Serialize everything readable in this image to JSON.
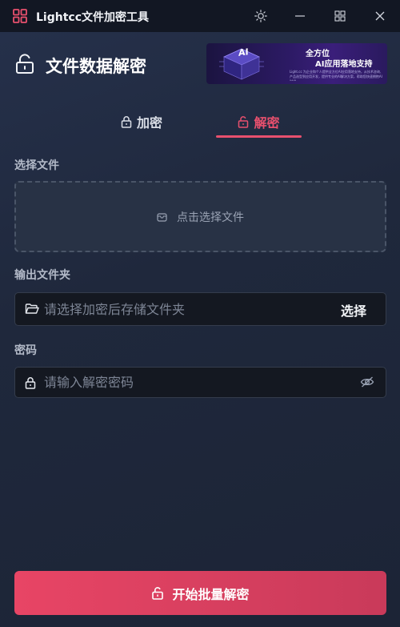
{
  "window": {
    "title": "Lightcc文件加密工具",
    "logo_icon": "grid-logo-icon",
    "theme_icon": "sun-icon",
    "minimize_icon": "minimize-icon",
    "maximize_icon": "maximize-icon",
    "close_icon": "close-icon"
  },
  "header": {
    "title": "文件数据解密",
    "icon": "unlock-icon",
    "banner": {
      "line1": "全方位",
      "line2": "AI应用落地支持",
      "badge": "AI",
      "small_text": "Light.cc 为企业和个人提供全方位AI应用落地支持，从技术咨询、产品选型到应用开发，提供专业的AI解决方案，帮助您快速拥抱AI时代。"
    }
  },
  "tabs": [
    {
      "label": "加密",
      "icon": "lock-icon",
      "active": false
    },
    {
      "label": "解密",
      "icon": "unlock-icon",
      "active": true
    }
  ],
  "file_section": {
    "label": "选择文件",
    "dropzone_text": "点击选择文件",
    "icon": "box-icon"
  },
  "output_section": {
    "label": "输出文件夹",
    "placeholder": "请选择加密后存储文件夹",
    "value": "",
    "button_label": "选择",
    "icon": "folder-open-icon"
  },
  "password_section": {
    "label": "密码",
    "placeholder": "请输入解密密码",
    "value": "",
    "icon": "lock-icon",
    "toggle_icon": "eye-off-icon"
  },
  "action": {
    "label": "开始批量解密",
    "icon": "unlock-icon"
  },
  "colors": {
    "accent": "#e8506e",
    "titlebar": "#121723",
    "background": "#1e2738",
    "input_bg": "#141821"
  }
}
